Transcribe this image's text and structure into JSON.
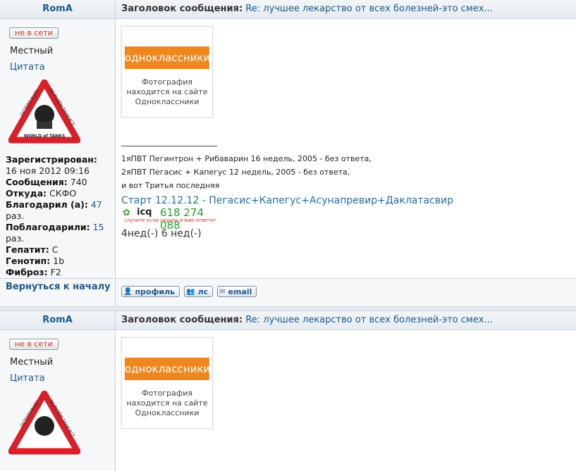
{
  "posts": [
    {
      "author": "RomA",
      "subject_label": "Заголовок сообщения:",
      "subject": "Re: лучшее лекарство от всех болезней-это смех...",
      "status": "не в сети",
      "rank": "Местный",
      "quote": "Цитата",
      "info": {
        "reg_label": "Зарегистрирован:",
        "reg_value": "16 ноя 2012 09:16",
        "msgs_label": "Сообщения:",
        "msgs_value": "740",
        "from_label": "Откуда:",
        "from_value": "СКФО",
        "thanked_label": "Благодарил (а):",
        "thanked_value": "47",
        "thanked_unit": "раз.",
        "gotthanks_label": "Поблагодарили:",
        "gotthanks_value": "15",
        "gotthanks_unit": "раз.",
        "hep_label": "Гепатит:",
        "hep_value": "C",
        "geno_label": "Генотип:",
        "geno_value": "1b",
        "fib_label": "Фиброз:",
        "fib_value": "F2"
      },
      "photo": {
        "brand": "одноклассники",
        "cap1": "Фотография",
        "cap2": "находится на сайте",
        "cap3": "Одноклассники"
      },
      "sig_line1": "1яПВТ Пегинтрон + Рибаварин 16 недель, 2005 - без ответа,",
      "sig_line2": "2яПВТ Пегасис + Капегус 12 недель, 2005 - без ответа,",
      "sig_line3": "и вот Тритья последняя",
      "start": "Старт 12.12.12 - Пегасис+Капегус+Асунапревир+Даклатасвир",
      "icq_word": "icq",
      "icq_number": "618 274 088",
      "icq_tag": "случите если скучно и вам ответят",
      "weeks": "4нед(-) 6 нед(-)",
      "back": "Вернуться к началу",
      "btn_profile": "профиль",
      "btn_pm": "лс",
      "btn_email": "email"
    },
    {
      "author": "RomA",
      "subject_label": "Заголовок сообщения:",
      "subject": "Re: лучшее лекарство от всех болезней-это смех...",
      "status": "не в сети",
      "rank": "Местный",
      "quote": "Цитата",
      "photo": {
        "brand": "одноклассники",
        "cap1": "Фотография",
        "cap2": "находится на сайте",
        "cap3": "Одноклассники"
      }
    }
  ],
  "avatar_text": {
    "left": "ОСТОРОЖНО!",
    "right": "ЗА РУЛЁМ ТАНКИСТ",
    "bottom": "WORLD of TANKS"
  }
}
